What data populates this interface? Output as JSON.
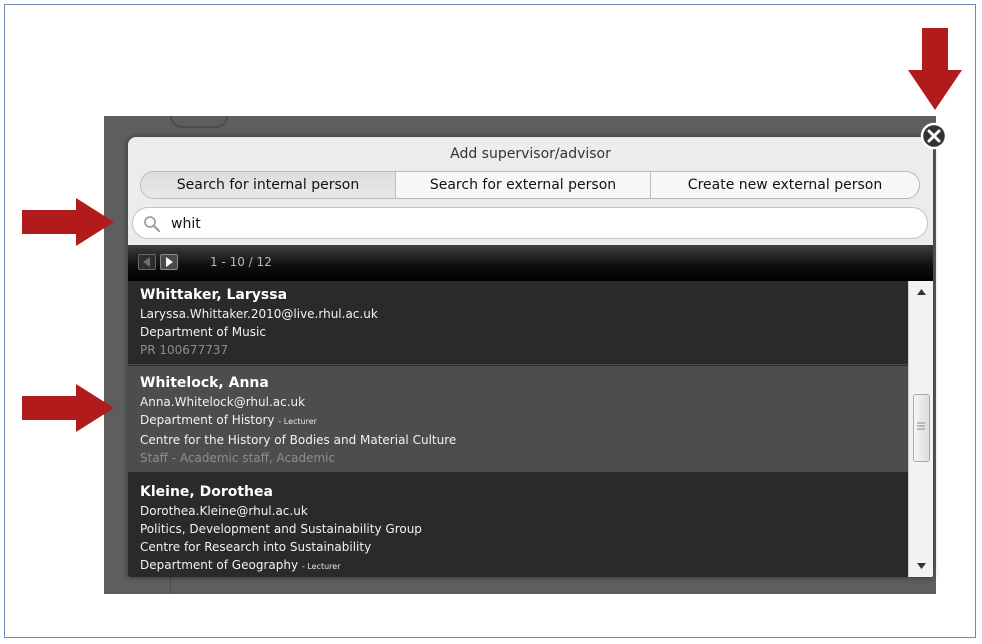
{
  "dialog": {
    "title": "Add supervisor/advisor",
    "tabs": [
      {
        "label": "Search for internal person",
        "active": true
      },
      {
        "label": "Search for external person",
        "active": false
      },
      {
        "label": "Create new external person",
        "active": false
      }
    ],
    "search": {
      "value": "whit"
    },
    "pager": {
      "count": "1 - 10 / 12"
    }
  },
  "results": [
    {
      "name": "Whittaker, Laryssa",
      "email": "Laryssa.Whittaker.2010@live.rhul.ac.uk",
      "dept": "Department of Music",
      "meta": "PR 100677737"
    },
    {
      "name": "Whitelock, Anna",
      "email": "Anna.Whitelock@rhul.ac.uk",
      "dept": "Department of History",
      "role": "- Lecturer",
      "centre": "Centre for the History of Bodies and Material Culture",
      "meta": "Staff - Academic staff, Academic"
    },
    {
      "name": "Kleine, Dorothea",
      "email": "Dorothea.Kleine@rhul.ac.uk",
      "group": "Politics, Development and Sustainability Group",
      "centre": "Centre for Research into Sustainability",
      "dept": "Department of Geography",
      "role": "- Lecturer"
    }
  ],
  "colors": {
    "arrow": "#b21b1b",
    "pager_bg": "#101010",
    "list_bg": "#2a2a2a",
    "selected_row": "#4d4d4d"
  }
}
